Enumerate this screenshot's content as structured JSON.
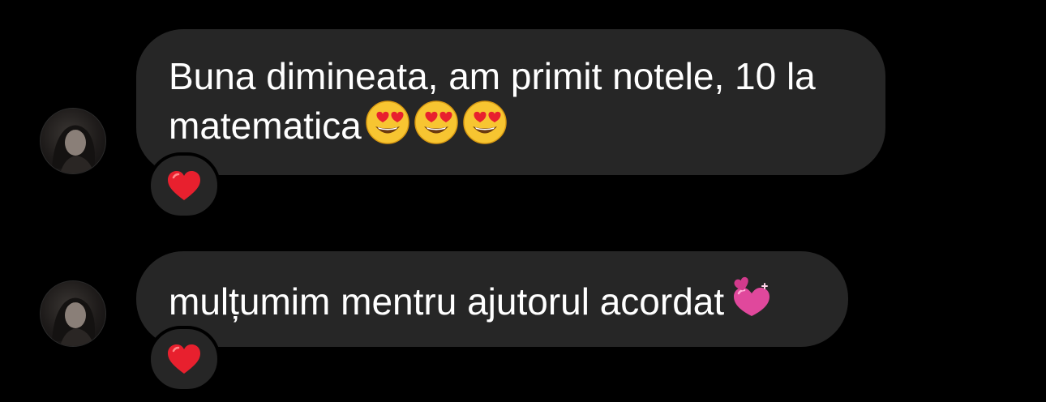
{
  "conversation": {
    "messages": [
      {
        "text": "Buna dimineata, am primit notele, 10 la matematica",
        "trailing_emojis": [
          "smiling-face-with-heart-eyes",
          "smiling-face-with-heart-eyes",
          "smiling-face-with-heart-eyes"
        ],
        "reaction": "red-heart"
      },
      {
        "text": "mulțumim mentru ajutorul acordat",
        "trailing_emojis": [
          "revolving-hearts"
        ],
        "reaction": "red-heart"
      }
    ]
  },
  "colors": {
    "background": "#000000",
    "bubble": "#262626",
    "text": "#ffffff",
    "heart": "#e8202e",
    "revolving_hearts": "#e0489c"
  }
}
